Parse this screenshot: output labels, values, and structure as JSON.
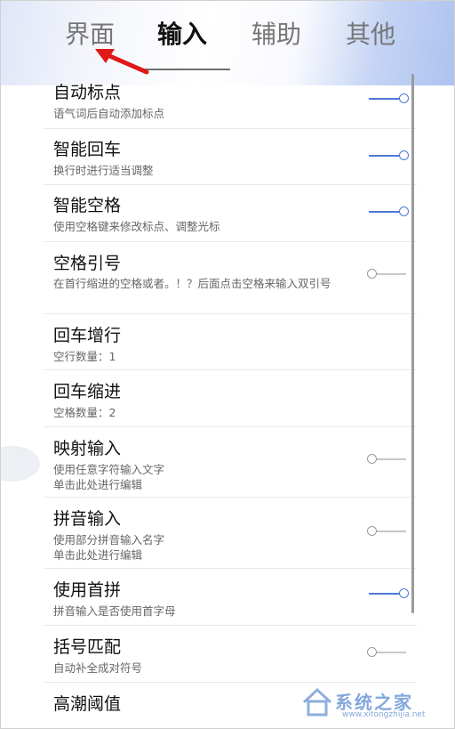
{
  "tabs": [
    {
      "label": "界面",
      "active": false
    },
    {
      "label": "输入",
      "active": true
    },
    {
      "label": "辅助",
      "active": false
    },
    {
      "label": "其他",
      "active": false
    }
  ],
  "settings": [
    {
      "title": "自动标点",
      "desc": "语气词后自动添加标点",
      "toggle": "on"
    },
    {
      "title": "智能回车",
      "desc": "换行时进行适当调整",
      "toggle": "on"
    },
    {
      "title": "智能空格",
      "desc": "使用空格键来修改标点、调整光标",
      "toggle": "on"
    },
    {
      "title": "空格引号",
      "desc": "在首行缩进的空格或者。！？后面点击空格来输入双引号",
      "toggle": "off"
    },
    {
      "title": "回车增行",
      "desc": "空行数量：1",
      "toggle": "none"
    },
    {
      "title": "回车缩进",
      "desc": "空格数量：2",
      "toggle": "none"
    },
    {
      "title": "映射输入",
      "desc": "使用任意字符输入文字\n单击此处进行编辑",
      "toggle": "off"
    },
    {
      "title": "拼音输入",
      "desc": "使用部分拼音输入名字\n单击此处进行编辑",
      "toggle": "off"
    },
    {
      "title": "使用首拼",
      "desc": "拼音输入是否使用首字母",
      "toggle": "on"
    },
    {
      "title": "括号匹配",
      "desc": "自动补全成对符号",
      "toggle": "off"
    },
    {
      "title": "高潮阈值",
      "desc": "",
      "toggle": "none"
    }
  ],
  "watermark": {
    "text": "系统之家",
    "url": "www.xitongzhijia.net"
  },
  "colors": {
    "accent": "#4e78d4",
    "annotation_arrow": "#e01818"
  }
}
